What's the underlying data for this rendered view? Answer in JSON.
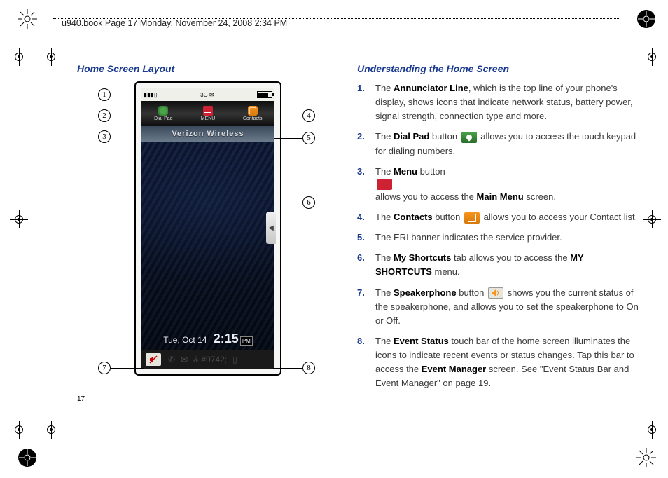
{
  "header": "u940.book  Page 17  Monday, November 24, 2008  2:34 PM",
  "page_number": "17",
  "left": {
    "title": "Home Screen Layout",
    "phone": {
      "toolbar": {
        "dial": "Dial Pad",
        "menu": "MENU",
        "contacts": "Contacts"
      },
      "banner": "Verizon Wireless",
      "shortcut_glyph": "◀",
      "date": "Tue, Oct 14",
      "time": "2:15",
      "ampm": "PM"
    },
    "callouts": {
      "c1": "1",
      "c2": "2",
      "c3": "3",
      "c4": "4",
      "c5": "5",
      "c6": "6",
      "c7": "7",
      "c8": "8"
    }
  },
  "right": {
    "title": "Understanding the Home Screen",
    "items": [
      {
        "n": "1.",
        "pre": "The ",
        "b1": "Annunciator Line",
        "post": ", which is the top line of your phone's display, shows icons that indicate network status, battery power, signal strength, connection type and more."
      },
      {
        "n": "2.",
        "pre": "The ",
        "b1": "Dial Pad",
        "mid": " button ",
        "icon": "dial",
        "post2": " allows you to access the touch keypad for dialing numbers."
      },
      {
        "n": "3.",
        "pre": "The ",
        "b1": "Menu",
        "mid": " button ",
        "icon": "menu",
        "post2": " allows you to access the ",
        "b2": "Main Menu",
        "post3": " screen."
      },
      {
        "n": "4.",
        "pre": "The ",
        "b1": "Contacts",
        "mid": " button ",
        "icon": "contacts",
        "post2": " allows you to access your Contact list."
      },
      {
        "n": "5.",
        "pre": "The ERI banner indicates the service provider."
      },
      {
        "n": "6.",
        "pre": "The ",
        "b1": "My Shortcuts",
        "mid": " tab allows you to access the ",
        "b2": "MY SHORTCUTS",
        "post3": " menu."
      },
      {
        "n": "7.",
        "pre": "The ",
        "b1": "Speakerphone",
        "mid": " button ",
        "icon": "speaker",
        "post2": " shows you the current status of the speakerphone, and allows you to set the speakerphone to On or Off."
      },
      {
        "n": "8.",
        "pre": "The ",
        "b1": "Event Status",
        "mid": " touch bar of the home screen illuminates the icons to indicate recent events or status changes. Tap this bar to access the ",
        "b2": "Event Manager",
        "post3": " screen. See \"Event Status Bar and Event Manager\" on page 19."
      }
    ]
  }
}
